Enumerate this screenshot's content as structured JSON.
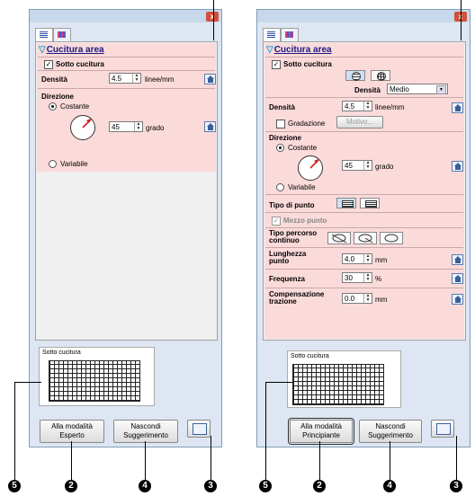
{
  "left": {
    "section_title": "Cucitura area",
    "underlay_label": "Sotto cucitura",
    "density_label": "Densità",
    "density_value": "4.5",
    "density_unit": "linee/mm",
    "direction_label": "Direzione",
    "constant_label": "Costante",
    "angle_value": "45",
    "angle_unit": "grado",
    "variable_label": "Variabile",
    "preview_label": "Sotto cucitura",
    "mode_button": "Alla modalità Esperto",
    "hide_button": "Nascondi Suggerimento"
  },
  "right": {
    "section_title": "Cucitura area",
    "underlay_label": "Sotto cucitura",
    "underlay_density_label": "Densità",
    "underlay_density_value": "Medio",
    "density_label": "Densità",
    "density_value": "4.5",
    "density_unit": "linee/mm",
    "gradation_label": "Gradazione",
    "pattern_button": "Motivo...",
    "direction_label": "Direzione",
    "constant_label": "Costante",
    "angle_value": "45",
    "angle_unit": "grado",
    "variable_label": "Variabile",
    "stitch_type_label": "Tipo di punto",
    "half_stitch_label": "Mezzo punto",
    "path_type_label": "Tipo percorso continuo",
    "stitch_length_label": "Lunghezza punto",
    "stitch_length_value": "4.0",
    "stitch_length_unit": "mm",
    "frequency_label": "Frequenza",
    "frequency_value": "30",
    "frequency_unit": "%",
    "pull_comp_label": "Compensazione trazione",
    "pull_comp_value": "0.0",
    "pull_comp_unit": "mm",
    "preview_label": "Sotto cucitura",
    "mode_button": "Alla modalità Principiante",
    "hide_button": "Nascondi Suggerimento"
  },
  "callouts": {
    "c5": "5",
    "c2": "2",
    "c4": "4",
    "c3": "3"
  },
  "close_glyph": "x",
  "check_glyph": "✓",
  "colors": {
    "section_bg": "#fbdada",
    "window_bg": "#dde6f2",
    "header_text": "#1a1a80"
  }
}
